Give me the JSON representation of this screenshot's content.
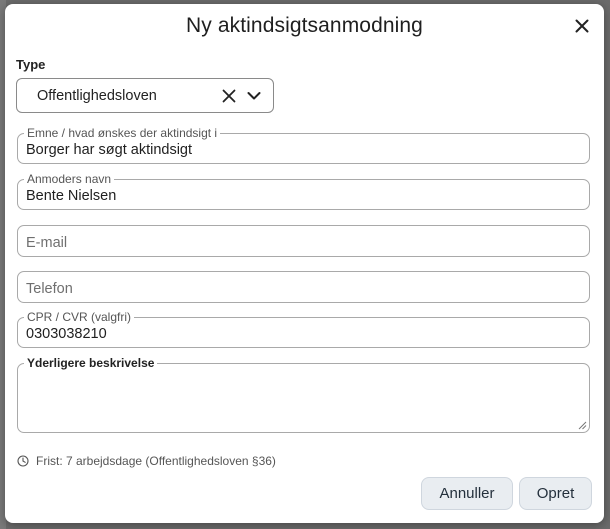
{
  "dialog": {
    "title": "Ny aktindsigtsanmodning",
    "close_icon": "close-icon"
  },
  "type": {
    "label": "Type",
    "value": "Offentlighedsloven",
    "clear_icon": "clear-icon",
    "chevron_icon": "chevron-down-icon"
  },
  "fields": {
    "subject": {
      "label": "Emne / hvad ønskes der aktindsigt i",
      "value": "Borger har søgt aktindsigt"
    },
    "name": {
      "label": "Anmoders navn",
      "value": "Bente Nielsen"
    },
    "email": {
      "placeholder": "E-mail",
      "value": ""
    },
    "phone": {
      "placeholder": "Telefon",
      "value": ""
    },
    "cpr": {
      "label": "CPR / CVR (valgfri)",
      "value": "0303038210"
    },
    "description": {
      "label": "Yderligere beskrivelse",
      "value": ""
    }
  },
  "deadline": {
    "icon": "clock-icon",
    "text": "Frist: 7 arbejdsdage (Offentlighedsloven §36)"
  },
  "buttons": {
    "cancel": "Annuller",
    "create": "Opret"
  },
  "colors": {
    "overlay": "#6b6b6b",
    "button_bg": "#e9edf1",
    "border": "#a9a9a9"
  }
}
